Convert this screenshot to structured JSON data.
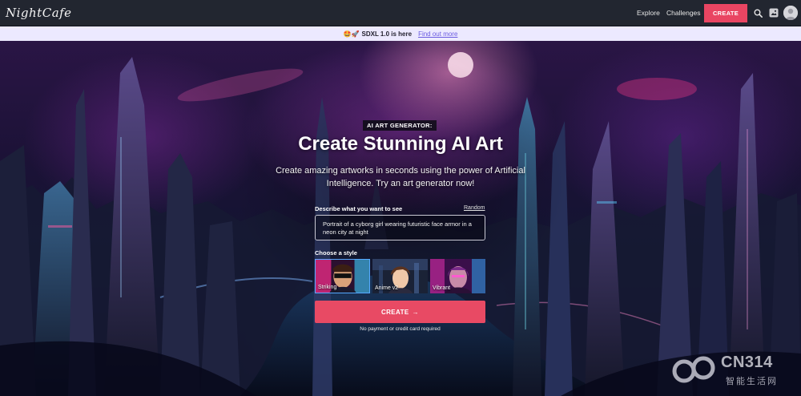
{
  "nav": {
    "logo": "NightCafe",
    "links": [
      "Explore",
      "Challenges"
    ],
    "create_label": "CREATE",
    "icons": [
      "search-icon",
      "gallery-icon",
      "avatar"
    ]
  },
  "announcement": {
    "emoji": "🤩🚀",
    "text": "SDXL 1.0 is here",
    "link": "Find out more"
  },
  "hero": {
    "badge": "AI ART GENERATOR:",
    "title": "Create Stunning AI Art",
    "subtitle": "Create amazing artworks in seconds using the power of Artificial Intelligence. Try an art generator now!"
  },
  "form": {
    "describe_label": "Describe what you want to see",
    "random_label": "Random",
    "prompt_value": "Portrait of a cyborg girl wearing futuristic face armor in a neon city at night",
    "style_label": "Choose a style",
    "styles": [
      {
        "name": "Striking",
        "selected": true
      },
      {
        "name": "Anime v2",
        "selected": false
      },
      {
        "name": "Vibrant",
        "selected": false
      }
    ],
    "create_label": "CREATE",
    "create_arrow": "→",
    "note": "No payment or credit card required"
  },
  "watermark": {
    "text": "CN314",
    "sub": "智能生活网"
  },
  "colors": {
    "accent": "#e94562",
    "topbar": "#222630",
    "announce_bg": "#ece9ff",
    "link": "#6b5be0",
    "selected_style_border": "#56a9ff"
  }
}
